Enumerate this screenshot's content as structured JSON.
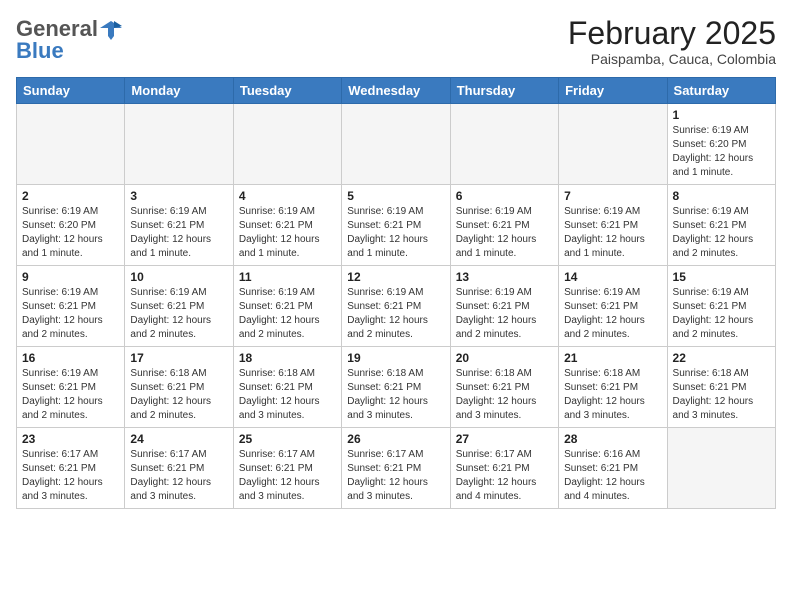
{
  "header": {
    "logo_general": "General",
    "logo_blue": "Blue",
    "month": "February 2025",
    "location": "Paispamba, Cauca, Colombia"
  },
  "days_of_week": [
    "Sunday",
    "Monday",
    "Tuesday",
    "Wednesday",
    "Thursday",
    "Friday",
    "Saturday"
  ],
  "weeks": [
    [
      {
        "day": "",
        "info": ""
      },
      {
        "day": "",
        "info": ""
      },
      {
        "day": "",
        "info": ""
      },
      {
        "day": "",
        "info": ""
      },
      {
        "day": "",
        "info": ""
      },
      {
        "day": "",
        "info": ""
      },
      {
        "day": "1",
        "info": "Sunrise: 6:19 AM\nSunset: 6:20 PM\nDaylight: 12 hours and 1 minute."
      }
    ],
    [
      {
        "day": "2",
        "info": "Sunrise: 6:19 AM\nSunset: 6:20 PM\nDaylight: 12 hours and 1 minute."
      },
      {
        "day": "3",
        "info": "Sunrise: 6:19 AM\nSunset: 6:21 PM\nDaylight: 12 hours and 1 minute."
      },
      {
        "day": "4",
        "info": "Sunrise: 6:19 AM\nSunset: 6:21 PM\nDaylight: 12 hours and 1 minute."
      },
      {
        "day": "5",
        "info": "Sunrise: 6:19 AM\nSunset: 6:21 PM\nDaylight: 12 hours and 1 minute."
      },
      {
        "day": "6",
        "info": "Sunrise: 6:19 AM\nSunset: 6:21 PM\nDaylight: 12 hours and 1 minute."
      },
      {
        "day": "7",
        "info": "Sunrise: 6:19 AM\nSunset: 6:21 PM\nDaylight: 12 hours and 1 minute."
      },
      {
        "day": "8",
        "info": "Sunrise: 6:19 AM\nSunset: 6:21 PM\nDaylight: 12 hours and 2 minutes."
      }
    ],
    [
      {
        "day": "9",
        "info": "Sunrise: 6:19 AM\nSunset: 6:21 PM\nDaylight: 12 hours and 2 minutes."
      },
      {
        "day": "10",
        "info": "Sunrise: 6:19 AM\nSunset: 6:21 PM\nDaylight: 12 hours and 2 minutes."
      },
      {
        "day": "11",
        "info": "Sunrise: 6:19 AM\nSunset: 6:21 PM\nDaylight: 12 hours and 2 minutes."
      },
      {
        "day": "12",
        "info": "Sunrise: 6:19 AM\nSunset: 6:21 PM\nDaylight: 12 hours and 2 minutes."
      },
      {
        "day": "13",
        "info": "Sunrise: 6:19 AM\nSunset: 6:21 PM\nDaylight: 12 hours and 2 minutes."
      },
      {
        "day": "14",
        "info": "Sunrise: 6:19 AM\nSunset: 6:21 PM\nDaylight: 12 hours and 2 minutes."
      },
      {
        "day": "15",
        "info": "Sunrise: 6:19 AM\nSunset: 6:21 PM\nDaylight: 12 hours and 2 minutes."
      }
    ],
    [
      {
        "day": "16",
        "info": "Sunrise: 6:19 AM\nSunset: 6:21 PM\nDaylight: 12 hours and 2 minutes."
      },
      {
        "day": "17",
        "info": "Sunrise: 6:18 AM\nSunset: 6:21 PM\nDaylight: 12 hours and 2 minutes."
      },
      {
        "day": "18",
        "info": "Sunrise: 6:18 AM\nSunset: 6:21 PM\nDaylight: 12 hours and 3 minutes."
      },
      {
        "day": "19",
        "info": "Sunrise: 6:18 AM\nSunset: 6:21 PM\nDaylight: 12 hours and 3 minutes."
      },
      {
        "day": "20",
        "info": "Sunrise: 6:18 AM\nSunset: 6:21 PM\nDaylight: 12 hours and 3 minutes."
      },
      {
        "day": "21",
        "info": "Sunrise: 6:18 AM\nSunset: 6:21 PM\nDaylight: 12 hours and 3 minutes."
      },
      {
        "day": "22",
        "info": "Sunrise: 6:18 AM\nSunset: 6:21 PM\nDaylight: 12 hours and 3 minutes."
      }
    ],
    [
      {
        "day": "23",
        "info": "Sunrise: 6:17 AM\nSunset: 6:21 PM\nDaylight: 12 hours and 3 minutes."
      },
      {
        "day": "24",
        "info": "Sunrise: 6:17 AM\nSunset: 6:21 PM\nDaylight: 12 hours and 3 minutes."
      },
      {
        "day": "25",
        "info": "Sunrise: 6:17 AM\nSunset: 6:21 PM\nDaylight: 12 hours and 3 minutes."
      },
      {
        "day": "26",
        "info": "Sunrise: 6:17 AM\nSunset: 6:21 PM\nDaylight: 12 hours and 3 minutes."
      },
      {
        "day": "27",
        "info": "Sunrise: 6:17 AM\nSunset: 6:21 PM\nDaylight: 12 hours and 4 minutes."
      },
      {
        "day": "28",
        "info": "Sunrise: 6:16 AM\nSunset: 6:21 PM\nDaylight: 12 hours and 4 minutes."
      },
      {
        "day": "",
        "info": ""
      }
    ]
  ]
}
